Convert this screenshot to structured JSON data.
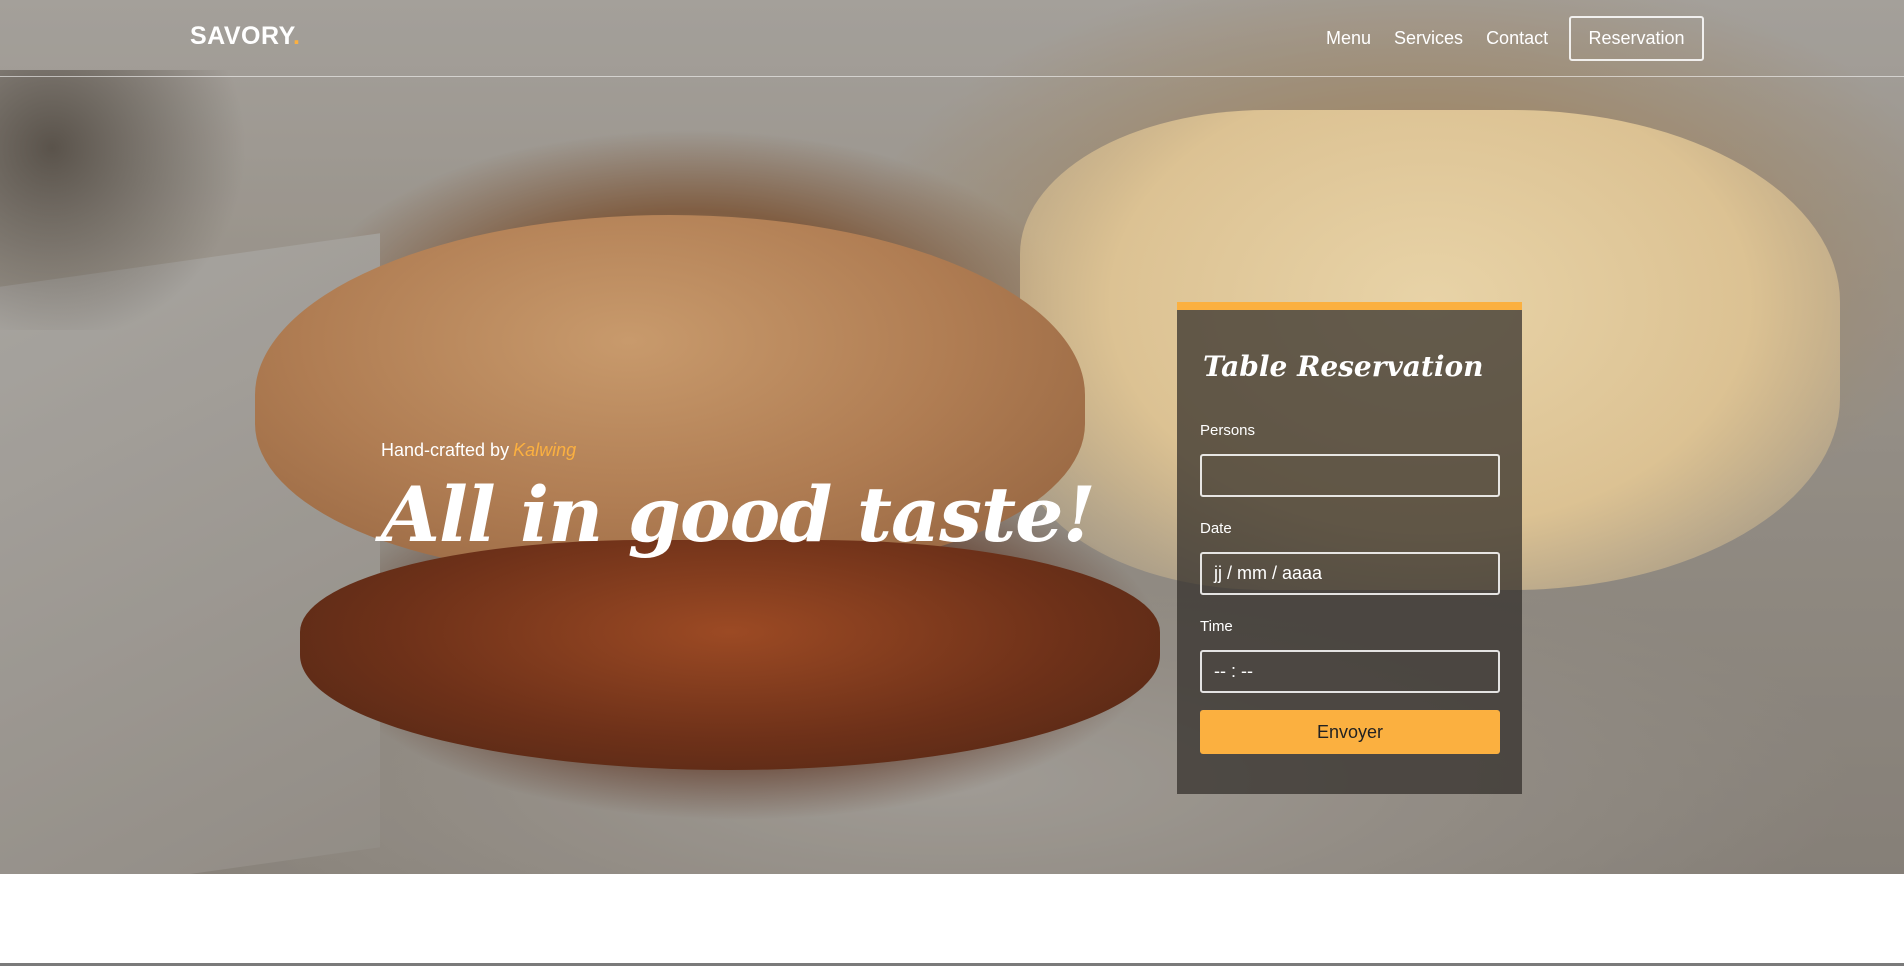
{
  "brand": {
    "name": "SAVORY",
    "dot": "."
  },
  "nav": {
    "items": [
      {
        "label": "Menu"
      },
      {
        "label": "Services"
      },
      {
        "label": "Contact"
      }
    ],
    "reservation_label": "Reservation"
  },
  "hero": {
    "tagline_prefix": "Hand-crafted by",
    "tagline_author": "Kalwing",
    "headline": "All in good taste!"
  },
  "reservation_form": {
    "title": "Table Reservation",
    "persons_label": "Persons",
    "persons_value": "",
    "date_label": "Date",
    "date_placeholder": "jj / mm / aaaa",
    "time_label": "Time",
    "time_placeholder": "-- : --",
    "submit_label": "Envoyer"
  },
  "colors": {
    "accent": "#fbb040",
    "text_light": "#ffffff"
  }
}
